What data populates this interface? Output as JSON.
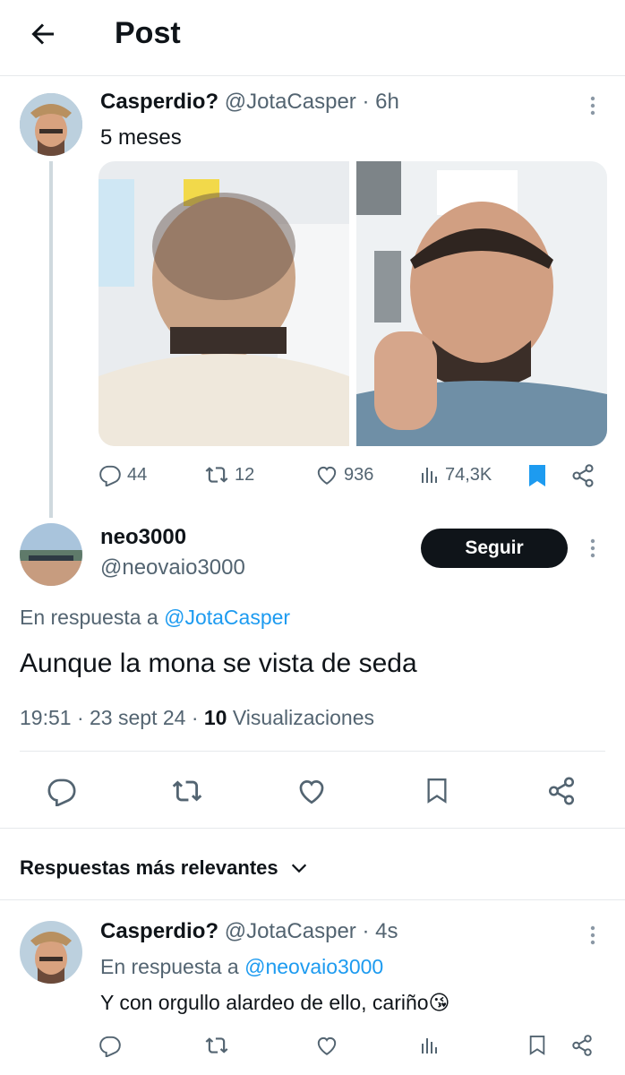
{
  "header": {
    "title": "Post",
    "back_icon": "arrow-left-icon"
  },
  "parent_tweet": {
    "display_name": "Casperdio?",
    "handle": "@JotaCasper",
    "separator": "·",
    "time": "6h",
    "text": "5 meses",
    "images": [
      "balding-head-photo",
      "smiling-man-photo"
    ],
    "actions": {
      "replies": "44",
      "retweets": "12",
      "likes": "936",
      "views": "74,3K"
    }
  },
  "main_tweet": {
    "display_name": "neo3000",
    "handle": "@neovaio3000",
    "follow_label": "Seguir",
    "reply_prefix": "En respuesta a",
    "reply_to": "@JotaCasper",
    "text": "Aunque la mona se vista de seda",
    "time": "19:51",
    "sep1": "·",
    "date": "23 sept 24",
    "sep2": "·",
    "views_count": "10",
    "views_label": "Visualizaciones"
  },
  "replies_section": {
    "sort_label": "Respuestas más relevantes"
  },
  "reply": {
    "display_name": "Casperdio?",
    "handle": "@JotaCasper",
    "separator": "·",
    "time": "4s",
    "reply_prefix": "En respuesta a",
    "reply_to": "@neovaio3000",
    "text": "Y con orgullo alardeo de ello, cariño😘"
  },
  "colors": {
    "accent": "#1d9bf0",
    "text": "#0f1419",
    "muted": "#536471",
    "bookmark_active": "#1d9bf0"
  }
}
